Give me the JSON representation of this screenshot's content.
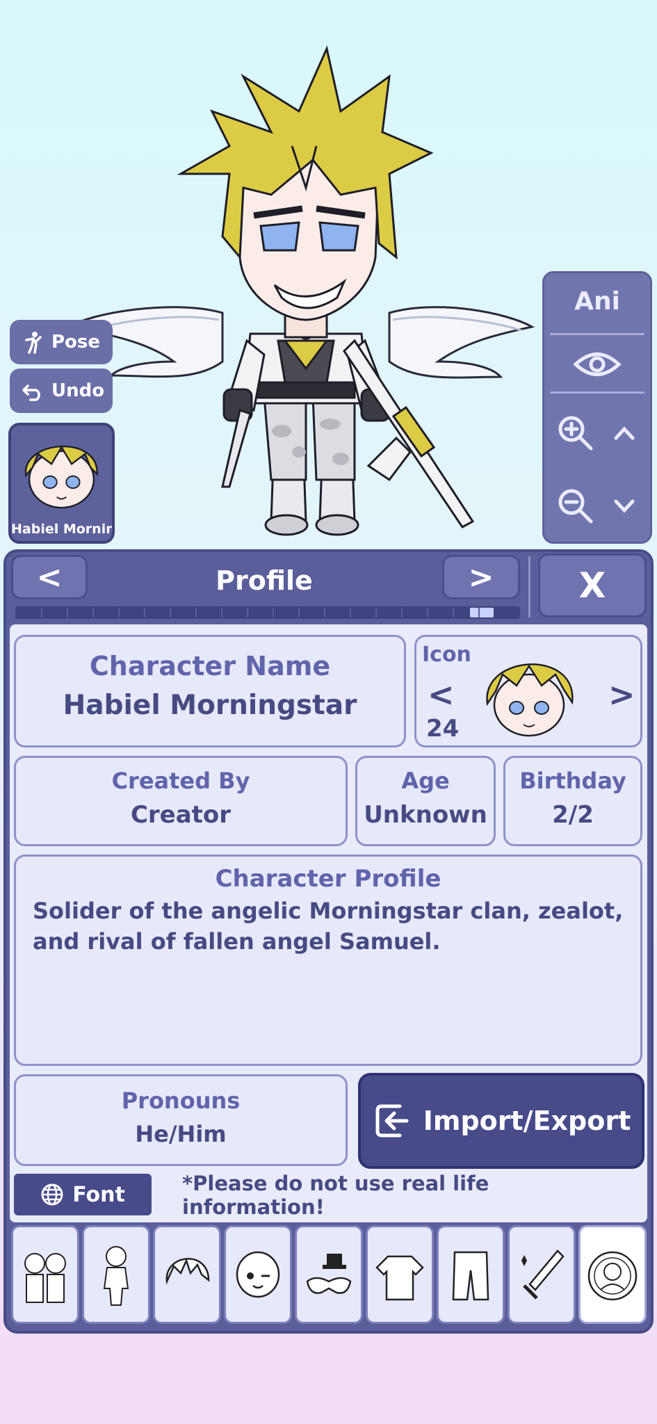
{
  "colors": {
    "panel": "#5a5e9a",
    "accent": "#474b8a",
    "label": "#6064ab",
    "hair": "#dccb45"
  },
  "toolbar": {
    "pose_label": "Pose",
    "undo_label": "Undo"
  },
  "avatar": {
    "name": "Habiel Mornin"
  },
  "ani_panel": {
    "label": "Ani",
    "icons": [
      "eye-icon",
      "zoom-in-icon",
      "chevron-up-icon",
      "zoom-out-icon",
      "chevron-down-icon"
    ]
  },
  "header": {
    "title": "Profile",
    "prev_label": "<",
    "next_label": ">",
    "close_label": "X",
    "progress": 0.95
  },
  "profile": {
    "character_name_label": "Character Name",
    "character_name": "Habiel Morningstar",
    "icon_label": "Icon",
    "icon_number": "24",
    "icon_prev": "<",
    "icon_next": ">",
    "created_by_label": "Created By",
    "created_by": "Creator",
    "age_label": "Age",
    "age": "Unknown",
    "birthday_label": "Birthday",
    "birthday": "2/2",
    "character_profile_label": "Character Profile",
    "character_profile": "Solider of the angelic Morningstar clan, zealot, and rival of fallen angel Samuel.",
    "pronouns_label": "Pronouns",
    "pronouns": "He/Him"
  },
  "actions": {
    "import_export_label": "Import/Export",
    "font_label": "Font"
  },
  "notice": "*Please do not use real life information!",
  "tabs": [
    "presets-tab",
    "body-tab",
    "hair-tab",
    "face-tab",
    "accessories-tab",
    "tops-tab",
    "bottoms-tab",
    "props-tab",
    "profile-tab"
  ],
  "active_tab": "profile-tab"
}
